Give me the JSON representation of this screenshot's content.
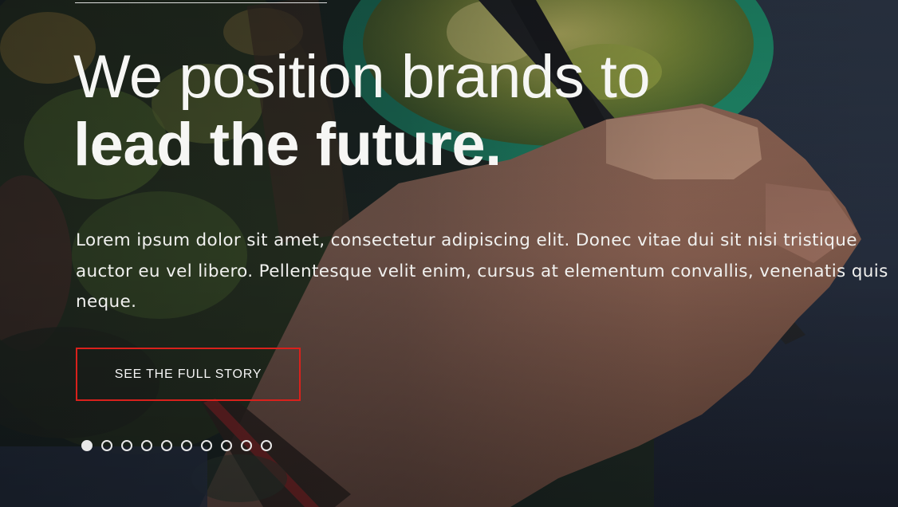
{
  "hero": {
    "headline_line1": "We position brands to",
    "headline_line2": "lead the future.",
    "body": "Lorem ipsum dolor sit amet, consectetur adipiscing elit. Donec vitae dui sit nisi tristique auctor eu vel libero. Pellentesque velit enim, cursus at elementum convallis, venenatis quis neque.",
    "cta_label": "SEE THE FULL STORY",
    "background_image": "photo of a tattooed hand holding chopsticks over a salad bowl"
  },
  "slider": {
    "slide_count": 10,
    "active_index": 0
  },
  "colors": {
    "cta_border": "#d9211c",
    "text": "#f6f6f4",
    "dot": "#e8e8e8"
  }
}
